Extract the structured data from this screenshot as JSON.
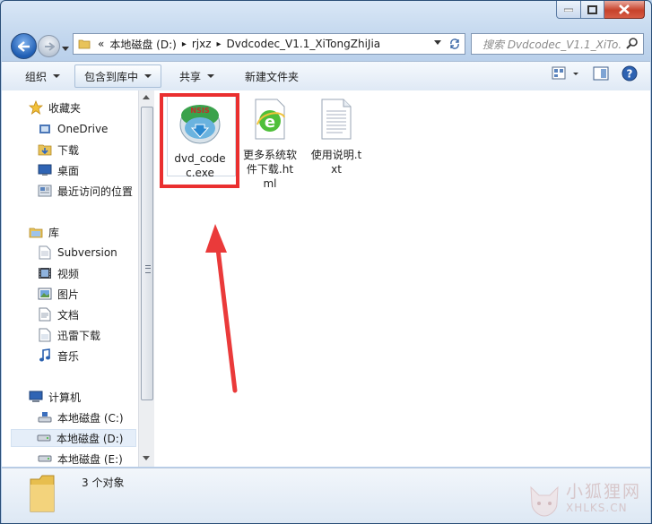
{
  "window": {
    "caption_buttons": [
      "minimize",
      "maximize",
      "close"
    ]
  },
  "address": {
    "overflow": "«",
    "crumbs": [
      "本地磁盘 (D:)",
      "rjxz",
      "Dvdcodec_V1.1_XiTongZhiJia"
    ]
  },
  "search": {
    "placeholder": "搜索 Dvdcodec_V1.1_XiTo..."
  },
  "toolbar": {
    "organize": "组织",
    "include_in_library": "包含到库中",
    "share": "共享",
    "new_folder": "新建文件夹"
  },
  "nav": {
    "favorites": "收藏夹",
    "onedrive": "OneDrive",
    "downloads": "下载",
    "desktop": "桌面",
    "recent": "最近访问的位置",
    "libraries": "库",
    "subversion": "Subversion",
    "videos": "视频",
    "pictures": "图片",
    "documents": "文档",
    "xunlei": "迅雷下载",
    "music": "音乐",
    "computer": "计算机",
    "drive_c": "本地磁盘 (C:)",
    "drive_d": "本地磁盘 (D:)",
    "drive_e": "本地磁盘 (E:)"
  },
  "files": [
    {
      "name": "dvd_codec.exe",
      "icon": "nsis-installer-icon",
      "badge": "NSIS"
    },
    {
      "name": "更多系统软件下载.html",
      "icon": "ie-html-icon"
    },
    {
      "name": "使用说明.txt",
      "icon": "text-file-icon"
    }
  ],
  "status": {
    "count": "3 个对象"
  },
  "watermark": {
    "cn": "小狐狸网",
    "en": "XHLKS.CN"
  },
  "colors": {
    "highlight": "#ea2f2f",
    "arrow": "#ea3a3a"
  }
}
